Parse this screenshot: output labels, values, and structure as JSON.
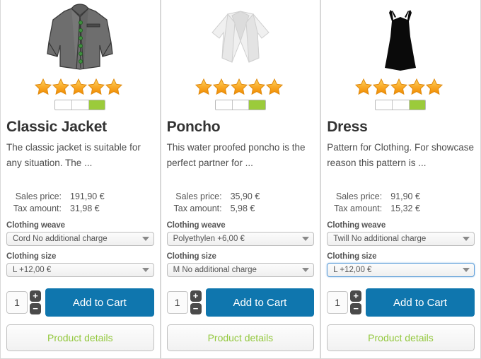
{
  "products": [
    {
      "image_icon": "jacket-image",
      "rating": {
        "stars": 5,
        "segments": 3,
        "filled_segments": 1,
        "fill_color": "#9bcb3b"
      },
      "title": "Classic Jacket",
      "description": "The classic jacket is suitable for any situation. The ...",
      "sales_price_label": "Sales price:",
      "sales_price_value": "191,90 €",
      "tax_label": "Tax amount:",
      "tax_value": "31,98 €",
      "weave_label": "Clothing weave",
      "weave_value": "Cord No additional charge",
      "size_label": "Clothing size",
      "size_value": "L +12,00 €",
      "size_focused": false,
      "quantity": "1",
      "increase_label": "+",
      "decrease_label": "−",
      "add_to_cart_label": "Add to Cart",
      "details_label": "Product details"
    },
    {
      "image_icon": "poncho-image",
      "rating": {
        "stars": 5,
        "segments": 3,
        "filled_segments": 1,
        "fill_color": "#9bcb3b"
      },
      "title": "Poncho",
      "description": "This water proofed poncho is the perfect partner for ...",
      "sales_price_label": "Sales price:",
      "sales_price_value": "35,90 €",
      "tax_label": "Tax amount:",
      "tax_value": "5,98 €",
      "weave_label": "Clothing weave",
      "weave_value": "Polyethylen +6,00 €",
      "size_label": "Clothing size",
      "size_value": "M No additional charge",
      "size_focused": false,
      "quantity": "1",
      "increase_label": "+",
      "decrease_label": "−",
      "add_to_cart_label": "Add to Cart",
      "details_label": "Product details"
    },
    {
      "image_icon": "dress-image",
      "rating": {
        "stars": 5,
        "segments": 3,
        "filled_segments": 1,
        "fill_color": "#9bcb3b"
      },
      "title": "Dress",
      "description": "Pattern for Clothing. For showcase reason this pattern is ...",
      "sales_price_label": "Sales price:",
      "sales_price_value": "91,90 €",
      "tax_label": "Tax amount:",
      "tax_value": "15,32 €",
      "weave_label": "Clothing weave",
      "weave_value": "Twill No additional charge",
      "size_label": "Clothing size",
      "size_value": "L +12,00 €",
      "size_focused": true,
      "quantity": "1",
      "increase_label": "+",
      "decrease_label": "−",
      "add_to_cart_label": "Add to Cart",
      "details_label": "Product details"
    }
  ],
  "colors": {
    "add_to_cart_bg": "#0f76ae",
    "details_text": "#93c83d",
    "star": "#f6a623",
    "rating_fill": "#9bcb3b",
    "focus_border": "#5b9dd9"
  }
}
